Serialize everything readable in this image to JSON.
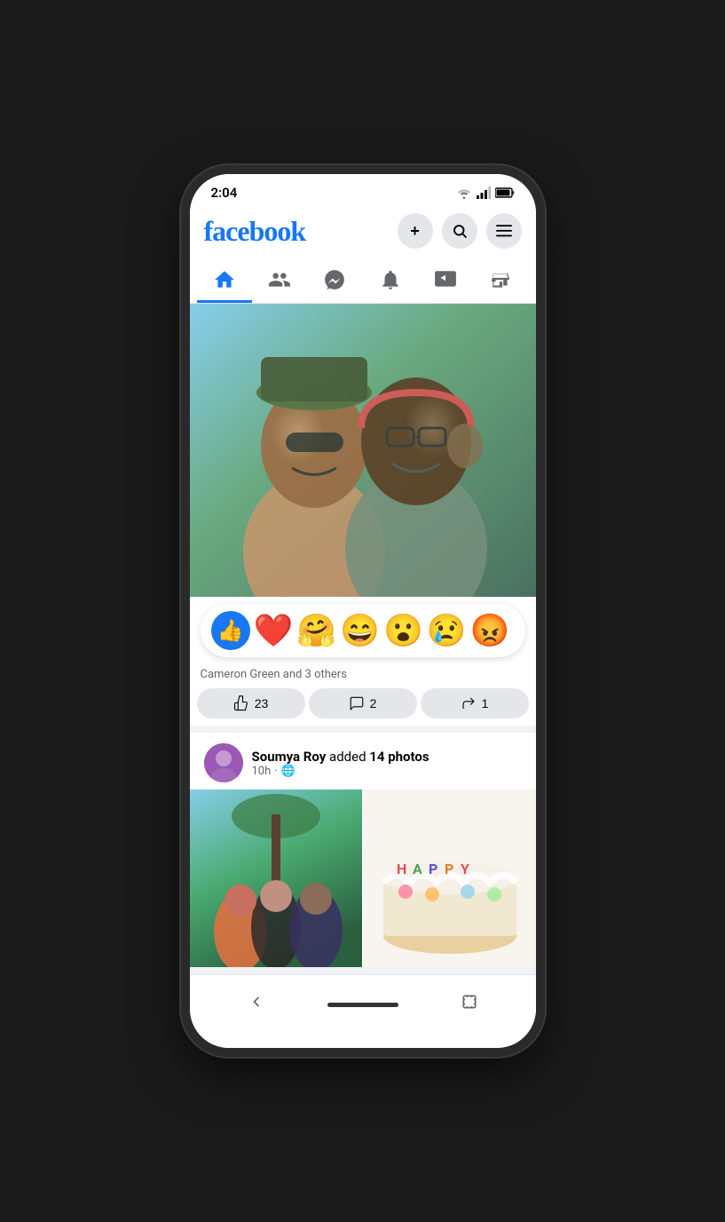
{
  "statusBar": {
    "time": "2:04",
    "batteryIcon": "🔋",
    "wifiIcon": "📶"
  },
  "header": {
    "logo": "facebook",
    "addBtn": "+",
    "searchBtn": "🔍",
    "menuBtn": "☰"
  },
  "navTabs": [
    {
      "id": "home",
      "label": "🏠",
      "active": true
    },
    {
      "id": "friends",
      "label": "👥",
      "active": false
    },
    {
      "id": "messenger",
      "label": "💬",
      "active": false
    },
    {
      "id": "notifications",
      "label": "🔔",
      "active": false
    },
    {
      "id": "watch",
      "label": "▶",
      "active": false
    },
    {
      "id": "marketplace",
      "label": "🏪",
      "active": false
    }
  ],
  "posts": [
    {
      "id": "post1",
      "reactions": {
        "like": "👍",
        "love": "❤️",
        "care": "🤗",
        "haha": "😄",
        "wow": "😮",
        "sad": "😢",
        "angry": "😡"
      },
      "reactors": "Cameron Green and 3 others",
      "likeCount": "23",
      "commentCount": "2",
      "shareCount": "1"
    },
    {
      "id": "post2",
      "author": "Soumya Roy",
      "activity": "added",
      "photoCount": "14 photos",
      "timeAgo": "10h",
      "privacy": "🌐"
    }
  ],
  "actions": {
    "like": "👍 23",
    "comment": "💬 2",
    "share": "↪ 1"
  },
  "bottomNav": {
    "backBtn": "‹",
    "homeIndicatorLabel": "home-pill",
    "rotateBtn": "⤢"
  }
}
